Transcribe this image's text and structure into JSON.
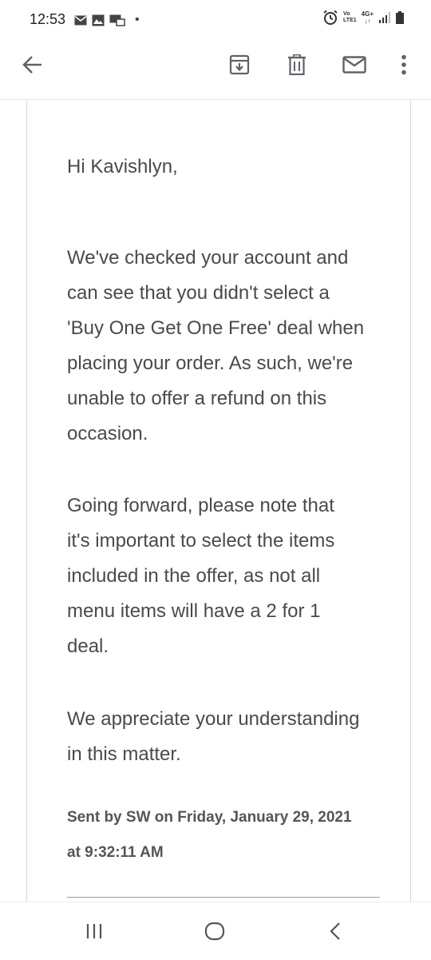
{
  "status_bar": {
    "time": "12:53",
    "dot": "•",
    "left_icons": [
      "mail-icon",
      "image-icon",
      "screen-icon"
    ],
    "right_icons": [
      "alarm-icon",
      "volte-icon",
      "4g-icon",
      "signal-icon",
      "battery-icon"
    ],
    "volte_label": "Vo",
    "lte_label": "LTE1",
    "network_label": "4G+"
  },
  "toolbar": {
    "icons": [
      "back-arrow-icon",
      "archive-icon",
      "trash-icon",
      "mail-icon",
      "more-vert-icon"
    ]
  },
  "email": {
    "greeting": "Hi Kavishlyn,",
    "paragraph1_lines": [
      "We've checked your account and",
      "can see that you didn't select a",
      "'Buy One Get One Free' deal when",
      "placing your order. As such, we're",
      "unable to offer a refund on this",
      "occasion."
    ],
    "paragraph2_lines": [
      "Going forward, please note that",
      "it's important to select the items",
      "included in the offer, as not all",
      "menu items will have a 2 for 1",
      "deal."
    ],
    "paragraph3_lines": [
      "We appreciate your understanding",
      "in this matter."
    ],
    "sent_lines": [
      "Sent by SW on Friday, January 29, 2021",
      "at 9:32:11 AM"
    ]
  },
  "nav_bar": {
    "icons": [
      "recents-icon",
      "home-icon",
      "back-icon"
    ]
  },
  "colors": {
    "text": "#4a4a4a",
    "icon": "#5f6368",
    "divider": "#e3e3e3"
  }
}
